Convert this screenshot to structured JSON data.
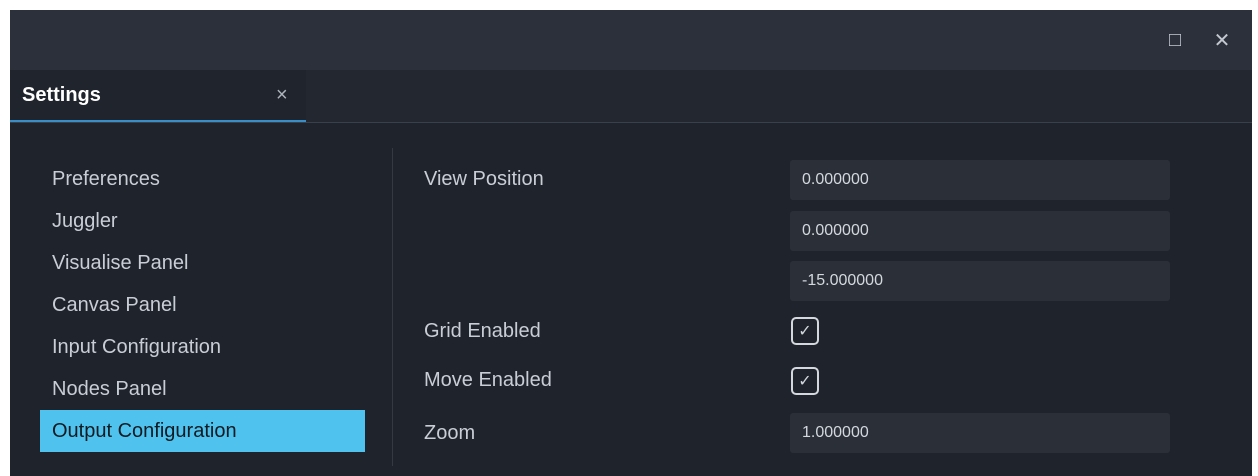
{
  "window": {
    "maximize_icon": "□",
    "close_icon": "✕"
  },
  "tab": {
    "label": "Settings",
    "close_icon": "×"
  },
  "sidebar": {
    "items": [
      {
        "label": "Preferences",
        "active": false
      },
      {
        "label": "Juggler",
        "active": false
      },
      {
        "label": "Visualise Panel",
        "active": false
      },
      {
        "label": "Canvas Panel",
        "active": false
      },
      {
        "label": "Input Configuration",
        "active": false
      },
      {
        "label": "Nodes Panel",
        "active": false
      },
      {
        "label": "Output Configuration",
        "active": true
      }
    ]
  },
  "settings": {
    "view_position": {
      "label": "View Position",
      "values": [
        "0.000000",
        "0.000000",
        "-15.000000"
      ]
    },
    "grid_enabled": {
      "label": "Grid Enabled",
      "checked": true
    },
    "move_enabled": {
      "label": "Move Enabled",
      "checked": true
    },
    "zoom": {
      "label": "Zoom",
      "value": "1.000000"
    },
    "check_glyph": "✓"
  },
  "colors": {
    "accent": "#4fc3ed",
    "background": "#1f232b",
    "titlebar": "#2b303a",
    "field": "#2a2f38"
  }
}
